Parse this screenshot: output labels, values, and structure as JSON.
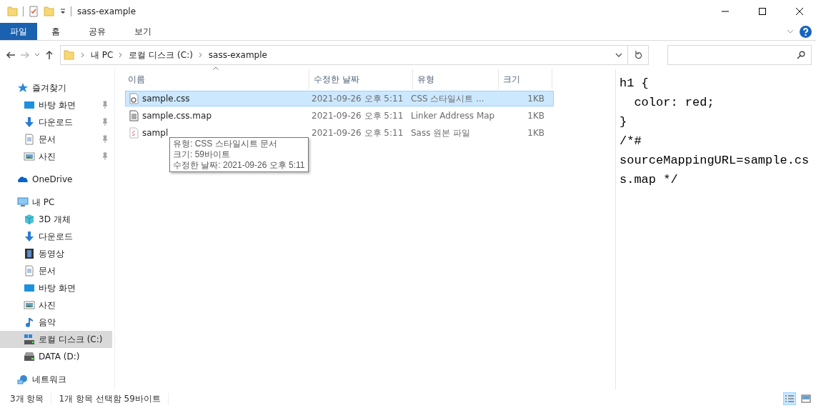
{
  "window": {
    "title": "sass-example"
  },
  "ribbon_tabs": [
    {
      "label": "파일",
      "selected": true
    },
    {
      "label": "홈",
      "selected": false
    },
    {
      "label": "공유",
      "selected": false
    },
    {
      "label": "보기",
      "selected": false
    }
  ],
  "address_bar": {
    "crumbs": [
      "내 PC",
      "로컬 디스크 (C:)",
      "sass-example"
    ]
  },
  "sidebar": {
    "sections": [
      {
        "label": "즐겨찾기",
        "selected": false,
        "children": [
          {
            "label": "바탕 화면",
            "pinned": true,
            "selected": false
          },
          {
            "label": "다운로드",
            "pinned": true,
            "selected": false
          },
          {
            "label": "문서",
            "pinned": true,
            "selected": false
          },
          {
            "label": "사진",
            "pinned": true,
            "selected": false
          }
        ]
      },
      {
        "label": "OneDrive",
        "selected": false
      },
      {
        "label": "내 PC",
        "selected": false,
        "children": [
          {
            "label": "3D 개체",
            "pinned": false,
            "selected": false
          },
          {
            "label": "다운로드",
            "pinned": false,
            "selected": false
          },
          {
            "label": "동영상",
            "pinned": false,
            "selected": false
          },
          {
            "label": "문서",
            "pinned": false,
            "selected": false
          },
          {
            "label": "바탕 화면",
            "pinned": false,
            "selected": false
          },
          {
            "label": "사진",
            "pinned": false,
            "selected": false
          },
          {
            "label": "음악",
            "pinned": false,
            "selected": false
          },
          {
            "label": "로컬 디스크 (C:)",
            "pinned": false,
            "selected": true
          },
          {
            "label": "DATA (D:)",
            "pinned": false,
            "selected": false
          }
        ]
      },
      {
        "label": "네트워크",
        "selected": false
      }
    ]
  },
  "table": {
    "columns": [
      {
        "label": "이름",
        "sorted": true
      },
      {
        "label": "수정한 날짜",
        "sorted": false
      },
      {
        "label": "유형",
        "sorted": false
      },
      {
        "label": "크기",
        "sorted": false
      }
    ],
    "rows": [
      {
        "kind": "css",
        "selected": true,
        "cells": [
          "sample.css",
          "2021-09-26 오후 5:11",
          "CSS 스타일시트 ...",
          "1KB"
        ]
      },
      {
        "kind": "map",
        "selected": false,
        "cells": [
          "sample.css.map",
          "2021-09-26 오후 5:11",
          "Linker Address Map",
          "1KB"
        ]
      },
      {
        "kind": "sass",
        "selected": false,
        "cells": [
          "sampl",
          "2021-09-26 오후 5:11",
          "Sass 원본 파일",
          "1KB"
        ]
      }
    ]
  },
  "tooltip": {
    "lines": [
      "유형: CSS 스타일시트 문서",
      "크기: 59바이트",
      "수정한 날짜: 2021-09-26 오후 5:11"
    ]
  },
  "preview": {
    "lines": [
      "h1 {",
      "  color: red;",
      "}",
      "/*#",
      "sourceMappingURL=sample.cs",
      "s.map */"
    ]
  },
  "status_bar": {
    "items": [
      "3개 항목",
      "1개 항목 선택함 59바이트"
    ],
    "view_buttons": [
      {
        "selected": true
      },
      {
        "selected": false
      }
    ]
  }
}
